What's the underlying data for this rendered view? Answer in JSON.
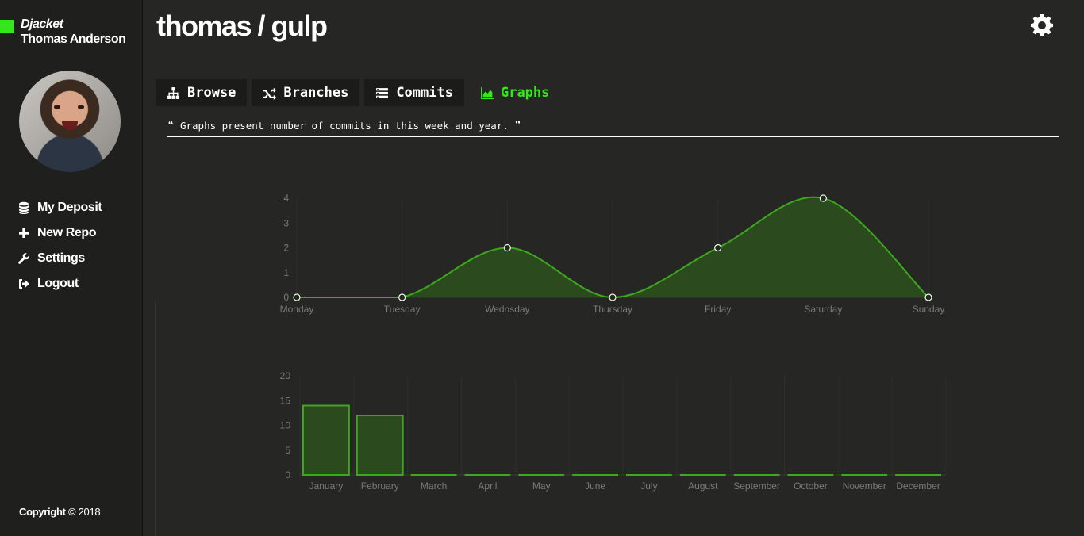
{
  "sidebar": {
    "brand": "Djacket",
    "user": "Thomas Anderson",
    "nav": [
      {
        "label": "My Deposit",
        "icon": "database-icon"
      },
      {
        "label": "New Repo",
        "icon": "plus-icon"
      },
      {
        "label": "Settings",
        "icon": "wrench-icon"
      },
      {
        "label": "Logout",
        "icon": "logout-icon"
      }
    ],
    "copyright_label": "Copyright ©",
    "copyright_year": "2018"
  },
  "header": {
    "title": "thomas / gulp",
    "settings_icon": "gear-icon"
  },
  "tabs": [
    {
      "label": "Browse",
      "icon": "sitemap-icon"
    },
    {
      "label": "Branches",
      "icon": "shuffle-icon"
    },
    {
      "label": "Commits",
      "icon": "list-icon"
    },
    {
      "label": "Graphs",
      "icon": "area-chart-icon",
      "active": true
    }
  ],
  "quote": {
    "open": "❝",
    "text": "Graphs present number of commits in this week and year.",
    "close": "❞"
  },
  "colors": {
    "accent": "#33e81a",
    "series_line": "#3ca81e",
    "series_fill": "#2b4a1e"
  },
  "chart_data": [
    {
      "type": "area",
      "categories": [
        "Monday",
        "Tuesday",
        "Wednsday",
        "Thursday",
        "Friday",
        "Saturday",
        "Sunday"
      ],
      "values": [
        0,
        0,
        2,
        0,
        2,
        4,
        0
      ],
      "ylim": [
        0,
        4
      ],
      "yticks": [
        0,
        1,
        2,
        3,
        4
      ],
      "grid": true
    },
    {
      "type": "bar",
      "categories": [
        "January",
        "February",
        "March",
        "April",
        "May",
        "June",
        "July",
        "August",
        "September",
        "October",
        "November",
        "December"
      ],
      "values": [
        14,
        12,
        0,
        0,
        0,
        0,
        0,
        0,
        0,
        0,
        0,
        0
      ],
      "ylim": [
        0,
        20
      ],
      "yticks": [
        0,
        5,
        10,
        15,
        20
      ],
      "grid": true
    }
  ]
}
